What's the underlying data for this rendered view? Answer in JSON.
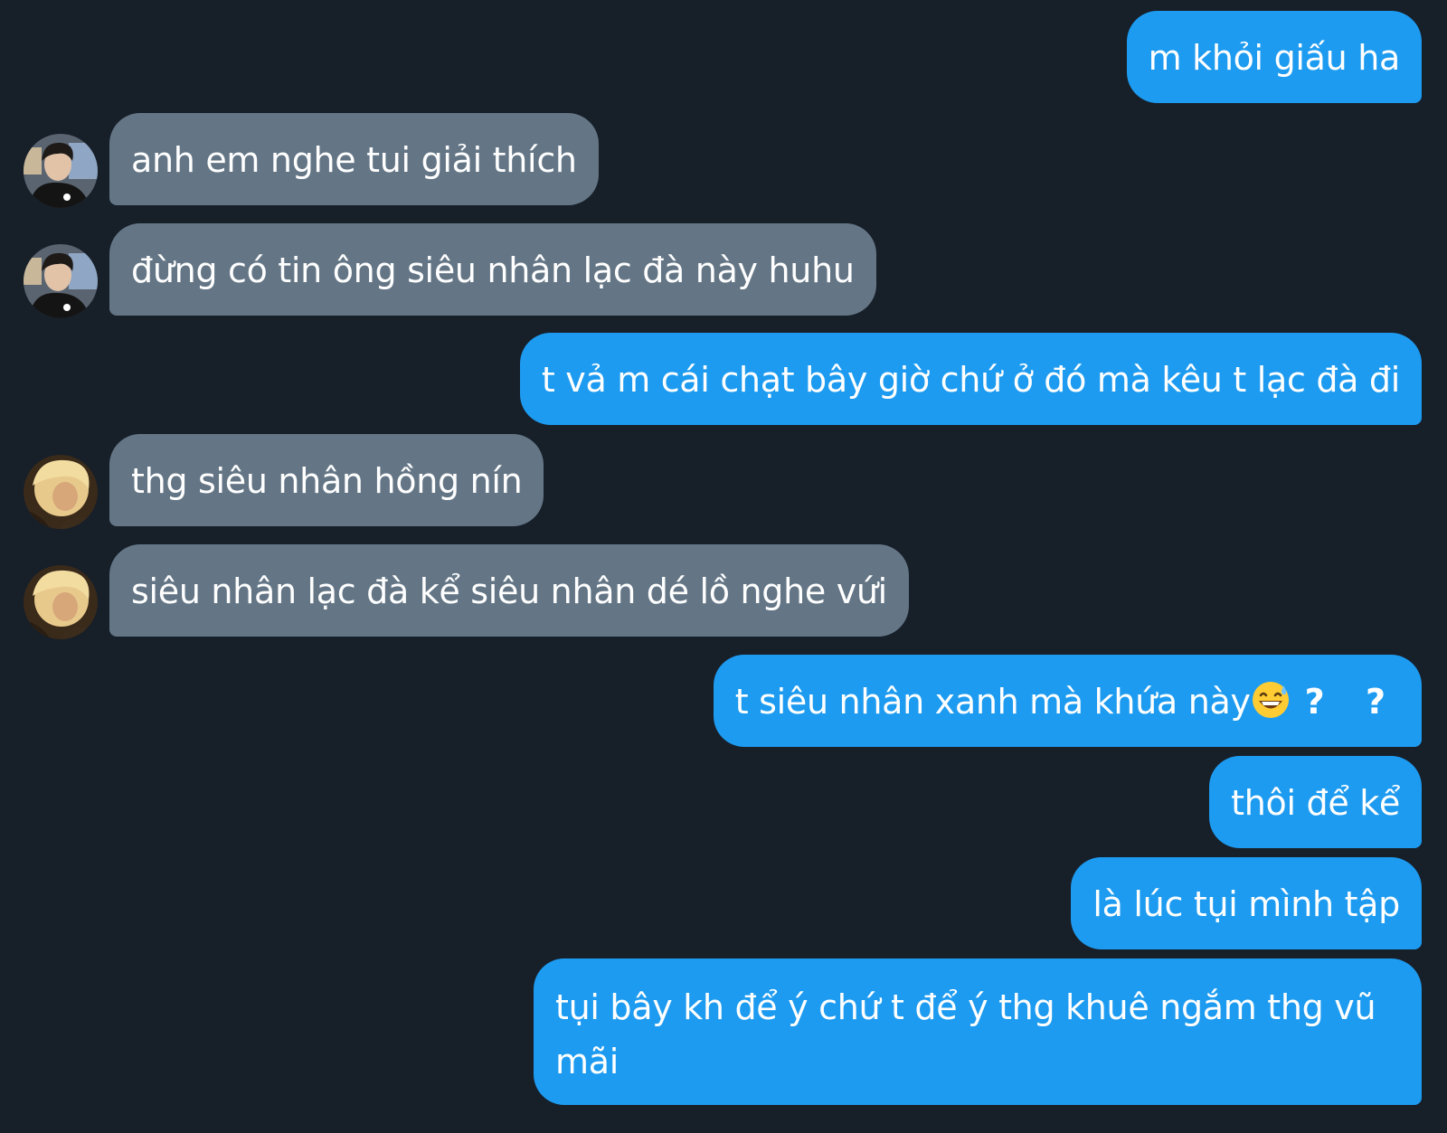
{
  "messages": [
    {
      "side": "out",
      "text": "m khỏi giấu ha"
    },
    {
      "side": "in",
      "sender_avatar": "dark-hair-avatar",
      "text": "anh em nghe tui giải thích"
    },
    {
      "side": "in",
      "sender_avatar": "dark-hair-avatar",
      "text": "đừng có tin ông siêu nhân lạc đà này huhu"
    },
    {
      "side": "out",
      "text": "t vả m cái chạt bây giờ chứ ở đó mà kêu t lạc đà đi"
    },
    {
      "side": "in",
      "sender_avatar": "blonde-hair-avatar",
      "text": "thg siêu nhân hồng nín"
    },
    {
      "side": "in",
      "sender_avatar": "blonde-hair-avatar",
      "text": "siêu nhân lạc đà kể siêu nhân dé lồ nghe vứi"
    },
    {
      "side": "out",
      "text": "t siêu nhân xanh mà khứa này",
      "emoji": "grinning-sweat-emoji",
      "suffix": "? ?"
    },
    {
      "side": "out",
      "text": "thôi để kể"
    },
    {
      "side": "out",
      "text": "là lúc tụi mình tập"
    },
    {
      "side": "out",
      "text": "tụi bây kh để ý chứ t để ý thg khuê ngắm thg vũ mãi"
    }
  ],
  "colors": {
    "background": "#171f29",
    "outgoing_bubble": "#1d9bf0",
    "incoming_bubble": "#647686",
    "text": "#ffffff"
  }
}
